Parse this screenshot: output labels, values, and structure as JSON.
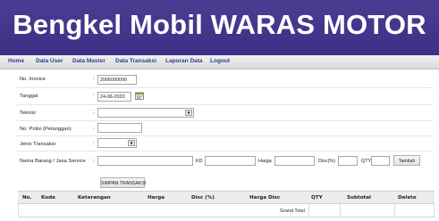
{
  "header": {
    "title": "Bengkel Mobil WARAS MOTOR"
  },
  "nav": {
    "items": [
      "Home",
      "Data User",
      "Data Master",
      "Data Transaksi",
      "Laporan Data",
      "Logout"
    ]
  },
  "form": {
    "colon": ":",
    "invoice": {
      "label": "No. Invoice",
      "value": "2006000006"
    },
    "tanggal": {
      "label": "Tanggal",
      "value": "24-06-2020"
    },
    "teknisi": {
      "label": "Teknisi",
      "value": ""
    },
    "polisi": {
      "label": "No. Polisi (Pelanggan)",
      "value": ""
    },
    "jenis": {
      "label": "Jenis Transaksi",
      "value": ""
    },
    "barang": {
      "label": "Nama Barang / Jasa Service",
      "kd_label": "KD",
      "harga_label": "Harga",
      "disc_label": "Disc(%)",
      "qty_label": "QTY",
      "tambah_label": "Tambah"
    },
    "simpan_label": "SIMPAN TRANSAKSI"
  },
  "table": {
    "columns": [
      "No.",
      "Kode",
      "Keterangan",
      "Harga",
      "Disc (%)",
      "Harga Disc",
      "QTY",
      "Subtotal",
      "Delete"
    ],
    "grand_total_label": "Grand Total"
  },
  "colors": {
    "banner": "#3d2f86",
    "nav_link": "#2a3f8f"
  },
  "icons": [
    "calendar-icon",
    "dropdown-arrow-icon"
  ]
}
